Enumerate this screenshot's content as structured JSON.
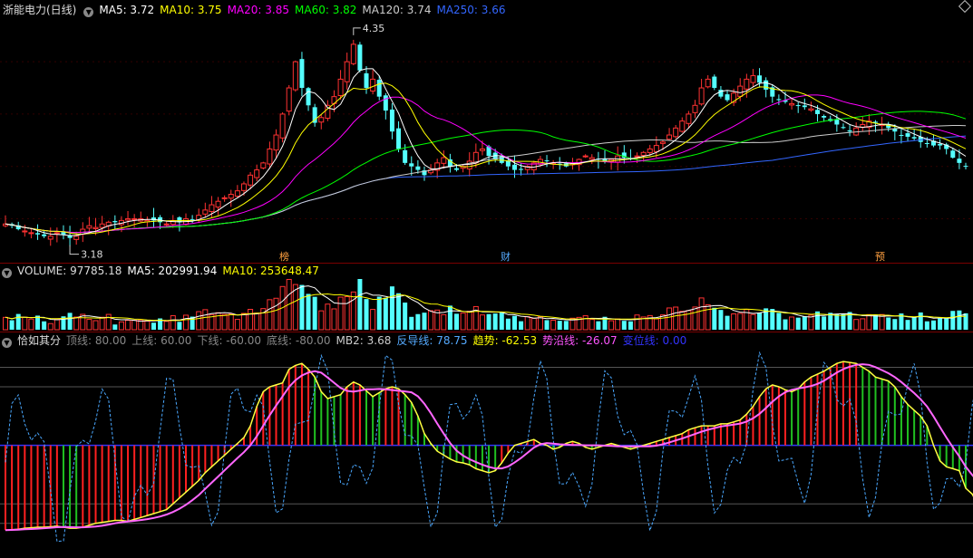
{
  "main_header": {
    "title": "浙能电力(日线)",
    "ma5": "MA5: 3.72",
    "ma10": "MA10: 3.75",
    "ma20": "MA20: 3.85",
    "ma60": "MA60: 3.82",
    "ma120": "MA120: 3.74",
    "ma250": "MA250: 3.66",
    "colors": {
      "title": "#dddddd",
      "ma5": "#ffffff",
      "ma10": "#ffff00",
      "ma20": "#ff00ff",
      "ma60": "#00ff00",
      "ma120": "#cccccc",
      "ma250": "#3366ff"
    }
  },
  "volume_header": {
    "title": "VOLUME: 97785.18",
    "ma5": "MA5: 202991.94",
    "ma10": "MA10: 253648.47"
  },
  "indicator_header": {
    "name": "恰如其分",
    "top": "顶线: 80.00",
    "upper": "上线: 60.00",
    "lower": "下线: -60.00",
    "bottom": "底线: -80.00",
    "mb2": "MB2: 3.68",
    "reverse": "反导线: 78.75",
    "trend": "趋势: -62.53",
    "trend_line": "势沿线: -26.07",
    "change": "变位线: 0.00"
  },
  "chart_data": [
    {
      "type": "candlestick",
      "title": "浙能电力(日线)",
      "ylim": [
        3.1,
        4.45
      ],
      "n_bars": 150,
      "annotations": {
        "high": "4.35",
        "low": "3.18"
      },
      "markers": [
        "榜",
        "财",
        "预"
      ],
      "close": [
        3.27,
        3.26,
        3.24,
        3.23,
        3.22,
        3.21,
        3.2,
        3.2,
        3.22,
        3.21,
        3.19,
        3.2,
        3.24,
        3.26,
        3.25,
        3.27,
        3.28,
        3.28,
        3.29,
        3.3,
        3.3,
        3.3,
        3.29,
        3.29,
        3.28,
        3.27,
        3.29,
        3.28,
        3.3,
        3.29,
        3.32,
        3.35,
        3.38,
        3.4,
        3.42,
        3.44,
        3.46,
        3.5,
        3.55,
        3.58,
        3.62,
        3.7,
        3.78,
        3.9,
        4.05,
        4.2,
        4.05,
        3.95,
        3.85,
        3.88,
        3.95,
        4.0,
        4.1,
        4.2,
        4.3,
        4.15,
        4.05,
        4.1,
        4.0,
        3.92,
        3.8,
        3.7,
        3.62,
        3.6,
        3.58,
        3.55,
        3.58,
        3.62,
        3.65,
        3.6,
        3.58,
        3.6,
        3.63,
        3.68,
        3.7,
        3.66,
        3.64,
        3.62,
        3.6,
        3.58,
        3.58,
        3.6,
        3.62,
        3.64,
        3.63,
        3.62,
        3.61,
        3.6,
        3.62,
        3.64,
        3.66,
        3.65,
        3.64,
        3.63,
        3.64,
        3.66,
        3.65,
        3.64,
        3.66,
        3.68,
        3.7,
        3.72,
        3.74,
        3.78,
        3.82,
        3.86,
        3.9,
        3.95,
        4.05,
        4.1,
        4.05,
        4.0,
        3.98,
        4.02,
        4.06,
        4.1,
        4.12,
        4.08,
        4.04,
        4.0,
        3.98,
        3.97,
        3.96,
        3.95,
        3.94,
        3.93,
        3.9,
        3.88,
        3.86,
        3.84,
        3.82,
        3.8,
        3.82,
        3.84,
        3.86,
        3.85,
        3.84,
        3.82,
        3.8,
        3.78,
        3.77,
        3.76,
        3.74,
        3.73,
        3.72,
        3.72,
        3.7,
        3.65,
        3.62,
        3.6
      ]
    },
    {
      "type": "bar",
      "title": "VOLUME",
      "series": [
        {
          "name": "VOLUME",
          "last": 97785.18
        },
        {
          "name": "MA5",
          "last": 202991.94
        },
        {
          "name": "MA10",
          "last": 253648.47
        }
      ]
    },
    {
      "type": "bar",
      "title": "恰如其分",
      "ylim": [
        -110,
        100
      ],
      "levels": {
        "top": 80,
        "upper": 60,
        "lower": -60,
        "bottom": -80
      },
      "mb2": 3.68,
      "trend": [
        -87.0,
        -86.5,
        -86.0,
        -85.0,
        -84.5,
        -84.0,
        -84.0,
        -83.5,
        -83.0,
        -84.0,
        -85.0,
        -85.0,
        -84.0,
        -82.0,
        -80.0,
        -79.0,
        -78.0,
        -77.0,
        -77.0,
        -78.0,
        -76.0,
        -74.0,
        -72.0,
        -70.0,
        -68.0,
        -66.0,
        -60.0,
        -54.0,
        -48.0,
        -42.0,
        -36.0,
        -28.0,
        -22.0,
        -16.0,
        -10.0,
        -4.0,
        2.0,
        8.0,
        20.0,
        40.0,
        55.0,
        60.0,
        62.0,
        64.0,
        78.0,
        82.0,
        84.0,
        78.0,
        70.0,
        55.0,
        48.0,
        50.0,
        52.0,
        60.0,
        65.0,
        62.0,
        56.0,
        50.0,
        54.0,
        58.0,
        60.0,
        58.0,
        52.0,
        44.0,
        30.0,
        12.0,
        2.0,
        -6.0,
        -10.0,
        -14.0,
        -17.0,
        -18.0,
        -20.0,
        -24.0,
        -26.0,
        -28.0,
        -26.0,
        -18.0,
        -8.0,
        0.0,
        2.0,
        4.0,
        6.0,
        2.0,
        0.0,
        -4.0,
        -2.0,
        2.0,
        4.0,
        2.0,
        -2.0,
        -4.0,
        -2.0,
        0.0,
        2.0,
        0.0,
        -2.0,
        -4.0,
        -2.0,
        0.0,
        2.0,
        4.0,
        6.0,
        8.0,
        10.0,
        12.0,
        16.0,
        18.0,
        20.0,
        20.0,
        20.0,
        22.0,
        22.0,
        24.0,
        26.0,
        32.0,
        40.0,
        50.0,
        58.0,
        62.0,
        60.0,
        57.0,
        55.0,
        58.0,
        65.0,
        70.0,
        73.0,
        76.0,
        80.0,
        84.0,
        86.0,
        85.0,
        84.0,
        80.0,
        76.0,
        70.0,
        68.0,
        66.0,
        60.0,
        50.0,
        42.0,
        36.0,
        30.0,
        20.0,
        0.0,
        -16.0,
        -22.0,
        -24.0,
        -26.0,
        -44.0,
        -50.0,
        -62.53
      ]
    }
  ]
}
